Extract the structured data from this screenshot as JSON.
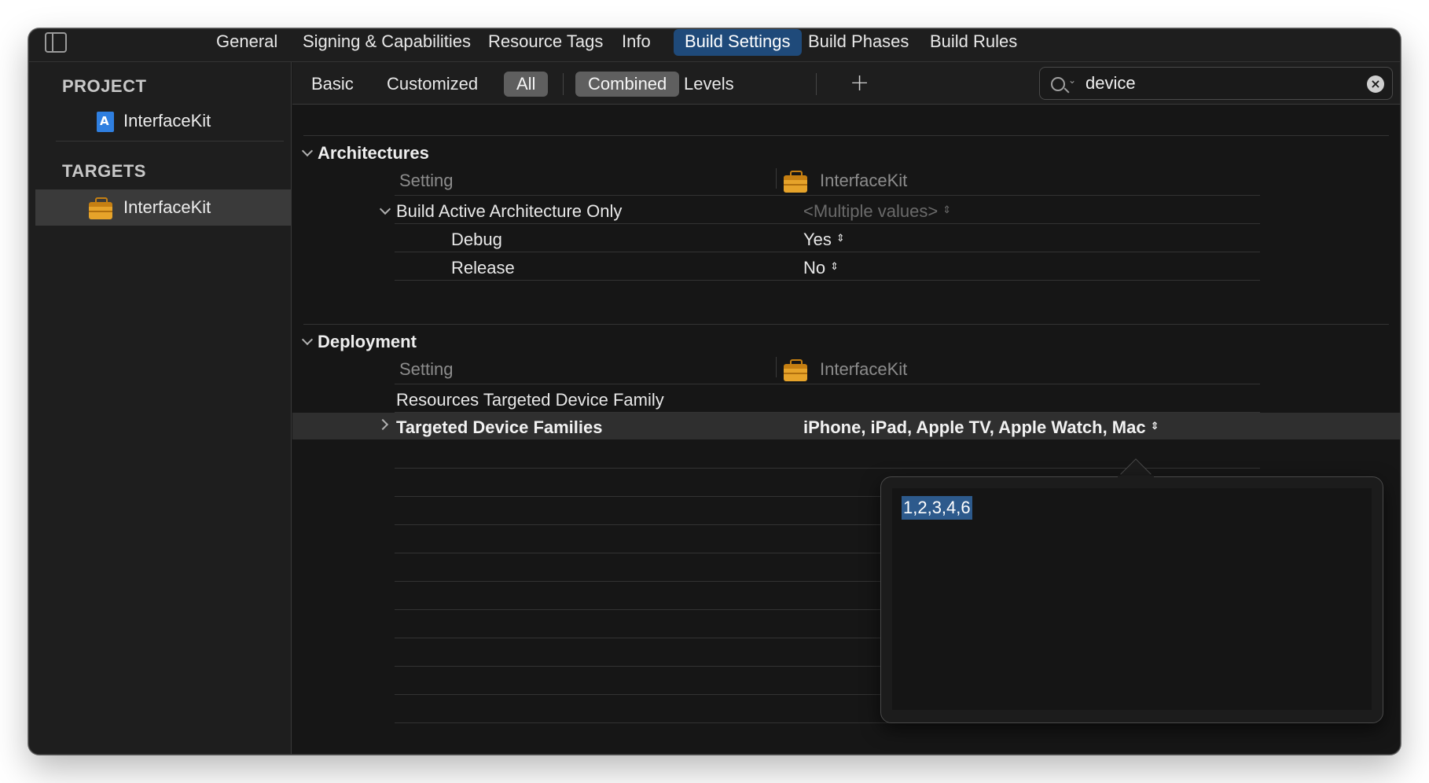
{
  "top_tabs": [
    {
      "label": "General"
    },
    {
      "label": "Signing & Capabilities"
    },
    {
      "label": "Resource Tags"
    },
    {
      "label": "Info"
    },
    {
      "label": "Build Settings"
    },
    {
      "label": "Build Phases"
    },
    {
      "label": "Build Rules"
    }
  ],
  "active_top_tab": "Build Settings",
  "sidebar": {
    "project_header": "PROJECT",
    "project_item": "InterfaceKit",
    "targets_header": "TARGETS",
    "target_item": "InterfaceKit"
  },
  "filter": {
    "tabs": [
      "Basic",
      "Customized",
      "All",
      "Combined",
      "Levels"
    ],
    "selected_scope": "All",
    "selected_view": "Combined",
    "add_symbol": "+",
    "search_value": "device",
    "search_placeholder": ""
  },
  "sections": {
    "architectures": {
      "title": "Architectures",
      "col_setting": "Setting",
      "col_target": "InterfaceKit",
      "rows": {
        "build_active_arch": {
          "name": "Build Active Architecture Only",
          "value": "<Multiple values>"
        },
        "debug": {
          "name": "Debug",
          "value": "Yes"
        },
        "release": {
          "name": "Release",
          "value": "No"
        }
      }
    },
    "deployment": {
      "title": "Deployment",
      "col_setting": "Setting",
      "col_target": "InterfaceKit",
      "rows": {
        "resources_family": {
          "name": "Resources Targeted Device Family",
          "value": ""
        },
        "targeted_families": {
          "name": "Targeted Device Families",
          "value": "iPhone, iPad, Apple TV, Apple Watch, Mac"
        }
      }
    }
  },
  "popover": {
    "value": "1,2,3,4,6"
  },
  "colors": {
    "accent_tab": "#1f4a7a",
    "selection": "#2d5a8c",
    "segment_on": "#5f5f5f",
    "toolbox": "#e6a32a",
    "project_icon": "#2f7fe0"
  },
  "icons": [
    "sidebar-toggle-icon",
    "project-file-icon",
    "toolbox-icon",
    "search-icon",
    "clear-icon",
    "chevron-down-icon",
    "chevron-right-icon",
    "stepper-icon",
    "plus-icon"
  ]
}
